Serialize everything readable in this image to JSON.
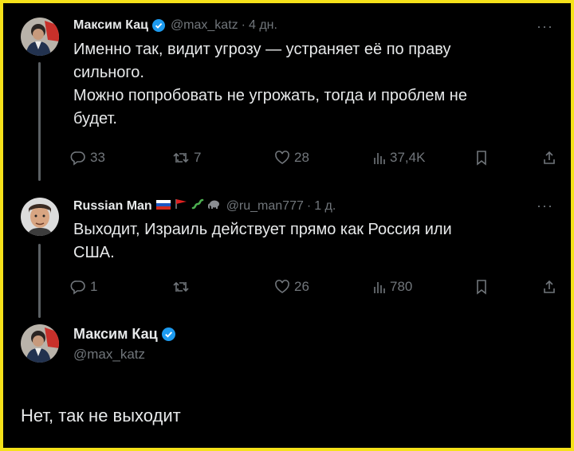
{
  "tweets": [
    {
      "name": "Максим Кац",
      "handle": "@max_katz",
      "time": "4 дн.",
      "text_lines": [
        "Именно так, видит угрозу — устраняет её по праву",
        "сильного.",
        "Можно попробовать не угрожать, тогда и проблем не",
        "будет."
      ],
      "replies": "33",
      "retweets": "7",
      "likes": "28",
      "views": "37,4K"
    },
    {
      "name": "Russian Man",
      "handle": "@ru_man777",
      "time": "1 д.",
      "text_lines": [
        "Выходит, Израиль действует прямо как Россия или",
        "США."
      ],
      "replies": "1",
      "retweets": "",
      "likes": "26",
      "views": "780"
    }
  ],
  "focused": {
    "name": "Максим Кац",
    "handle": "@max_katz",
    "text": "Нет, так не выходит"
  },
  "separator": "·",
  "more_label": "···",
  "colors": {
    "verified": "#1d9bf0",
    "muted": "#71767b",
    "text": "#e7e9ea",
    "frame": "#f5e21a"
  }
}
